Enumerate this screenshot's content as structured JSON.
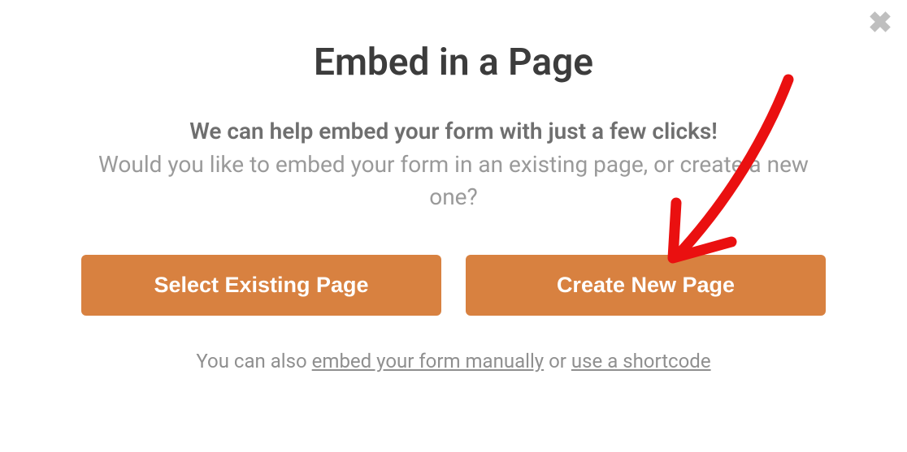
{
  "modal": {
    "title": "Embed in a Page",
    "help_bold": "We can help embed your form with just a few clicks!",
    "help_regular": "Would you like to embed your form in an existing page, or create a new one?",
    "button_existing": "Select Existing Page",
    "button_new": "Create New Page",
    "footer_prefix": "You can also ",
    "footer_link_manual": "embed your form manually",
    "footer_or": " or ",
    "footer_link_shortcode": "use a shortcode"
  }
}
